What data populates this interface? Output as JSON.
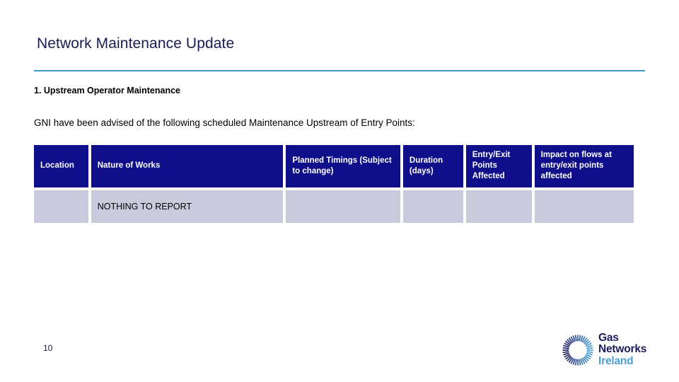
{
  "slide": {
    "title": "Network Maintenance Update",
    "page_number": "10",
    "accent_rule_color": "#3e9cbf",
    "title_color": "#1a1a55"
  },
  "section": {
    "heading": "1. Upstream Operator Maintenance",
    "intro": "GNI have been advised of the following scheduled Maintenance Upstream of Entry Points:"
  },
  "table": {
    "header_bg": "#0f0f8c",
    "header_text_color": "#ffffff",
    "row_bg": "#c9cbdd",
    "columns": [
      {
        "label": "Location",
        "align": "middle"
      },
      {
        "label": "Nature of Works",
        "align": "middle"
      },
      {
        "label": "Planned Timings (Subject to change)",
        "align": "middle"
      },
      {
        "label": "Duration (days)",
        "align": "middle"
      },
      {
        "label": "Entry/Exit Points Affected",
        "align": "top"
      },
      {
        "label": "Impact on flows at entry/exit points affected",
        "align": "top"
      }
    ],
    "rows": [
      {
        "location": "",
        "nature_of_works": "NOTHING TO REPORT",
        "planned_timings": "",
        "duration": "",
        "entry_exit_points": "",
        "impact": ""
      }
    ]
  },
  "logo": {
    "line1": "Gas",
    "line2": "Networks",
    "line3": "Ireland",
    "primary_color": "#1b1b60",
    "accent_color": "#4a9fd4"
  }
}
